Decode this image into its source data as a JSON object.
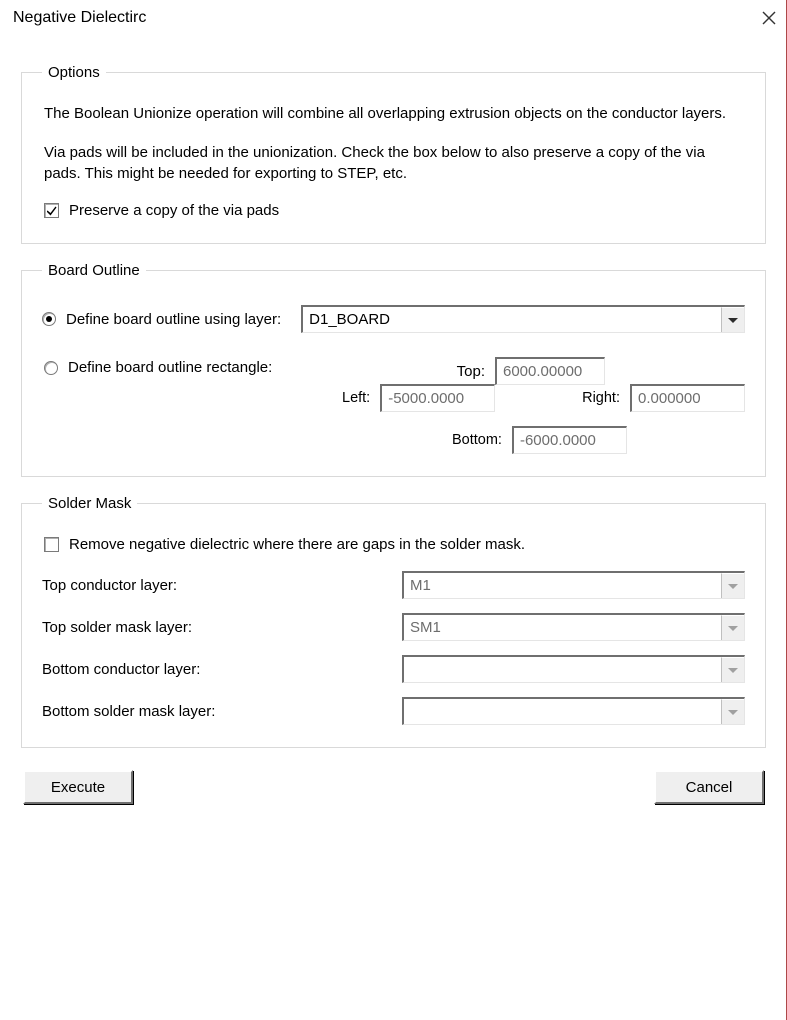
{
  "window": {
    "title": "Negative Dielectirc"
  },
  "options": {
    "legend": "Options",
    "para1": "The Boolean Unionize operation will combine all overlapping extrusion objects on the conductor layers.",
    "para2": "Via pads will be included in the unionization. Check the box below to also preserve a copy of the via pads. This might be needed for exporting to STEP, etc.",
    "preserve_label": "Preserve a copy of the via pads",
    "preserve_checked": true
  },
  "board_outline": {
    "legend": "Board Outline",
    "mode": "layer",
    "radio_layer_label": "Define board outline using layer:",
    "radio_rect_label": "Define board outline rectangle:",
    "layer_value": "D1_BOARD",
    "labels": {
      "top": "Top:",
      "left": "Left:",
      "right": "Right:",
      "bottom": "Bottom:"
    },
    "rect": {
      "top": "6000.00000",
      "left": "-5000.0000",
      "right": "0.000000",
      "bottom": "-6000.0000"
    },
    "rect_enabled": false
  },
  "solder_mask": {
    "legend": "Solder Mask",
    "remove_label": "Remove negative dielectric where there are gaps in the solder mask.",
    "remove_checked": false,
    "rows": {
      "top_conductor": {
        "label": "Top conductor layer:",
        "value": "M1",
        "enabled": false
      },
      "top_solder": {
        "label": "Top solder mask layer:",
        "value": "SM1",
        "enabled": false
      },
      "bottom_conductor": {
        "label": "Bottom conductor layer:",
        "value": "",
        "enabled": false
      },
      "bottom_solder": {
        "label": "Bottom solder mask layer:",
        "value": "",
        "enabled": false
      }
    }
  },
  "buttons": {
    "execute": "Execute",
    "cancel": "Cancel"
  }
}
